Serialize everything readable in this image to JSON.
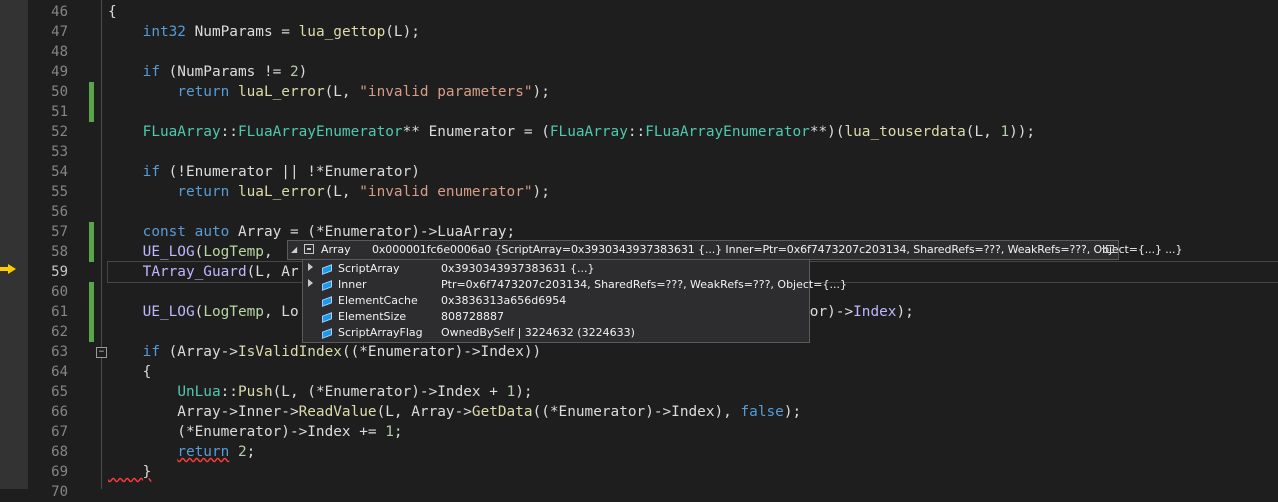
{
  "editor": {
    "line_numbers": [
      "46",
      "47",
      "48",
      "49",
      "50",
      "51",
      "52",
      "53",
      "54",
      "55",
      "56",
      "57",
      "58",
      "59",
      "60",
      "61",
      "62",
      "63",
      "64",
      "65",
      "66",
      "67",
      "68",
      "69",
      "70"
    ],
    "current_line_number": "59",
    "lines": [
      {
        "n": "46",
        "tokens": [
          {
            "t": "{",
            "c": "plain"
          }
        ]
      },
      {
        "n": "47",
        "tokens": [
          {
            "t": "    ",
            "c": "plain"
          },
          {
            "t": "int32",
            "c": "kw"
          },
          {
            "t": " NumParams = ",
            "c": "plain"
          },
          {
            "t": "lua_gettop",
            "c": "fn"
          },
          {
            "t": "(L);",
            "c": "plain"
          }
        ]
      },
      {
        "n": "48",
        "tokens": []
      },
      {
        "n": "49",
        "tokens": [
          {
            "t": "    ",
            "c": "plain"
          },
          {
            "t": "if",
            "c": "kw"
          },
          {
            "t": " (NumParams != ",
            "c": "plain"
          },
          {
            "t": "2",
            "c": "num"
          },
          {
            "t": ")",
            "c": "plain"
          }
        ]
      },
      {
        "n": "50",
        "tokens": [
          {
            "t": "        ",
            "c": "plain"
          },
          {
            "t": "return",
            "c": "kw"
          },
          {
            "t": " ",
            "c": "plain"
          },
          {
            "t": "luaL_error",
            "c": "fn"
          },
          {
            "t": "(L, ",
            "c": "plain"
          },
          {
            "t": "\"invalid parameters\"",
            "c": "str"
          },
          {
            "t": ");",
            "c": "plain"
          }
        ]
      },
      {
        "n": "51",
        "tokens": []
      },
      {
        "n": "52",
        "tokens": [
          {
            "t": "    ",
            "c": "plain"
          },
          {
            "t": "FLuaArray",
            "c": "type"
          },
          {
            "t": "::",
            "c": "plain"
          },
          {
            "t": "FLuaArrayEnumerator",
            "c": "type"
          },
          {
            "t": "** Enumerator = (",
            "c": "plain"
          },
          {
            "t": "FLuaArray",
            "c": "type"
          },
          {
            "t": "::",
            "c": "plain"
          },
          {
            "t": "FLuaArrayEnumerator",
            "c": "type"
          },
          {
            "t": "**)(",
            "c": "plain"
          },
          {
            "t": "lua_touserdata",
            "c": "fn"
          },
          {
            "t": "(L, ",
            "c": "plain"
          },
          {
            "t": "1",
            "c": "num"
          },
          {
            "t": "));",
            "c": "plain"
          }
        ]
      },
      {
        "n": "53",
        "tokens": []
      },
      {
        "n": "54",
        "tokens": [
          {
            "t": "    ",
            "c": "plain"
          },
          {
            "t": "if",
            "c": "kw"
          },
          {
            "t": " (!Enumerator || !*Enumerator)",
            "c": "plain"
          }
        ]
      },
      {
        "n": "55",
        "tokens": [
          {
            "t": "        ",
            "c": "plain"
          },
          {
            "t": "return",
            "c": "kw"
          },
          {
            "t": " ",
            "c": "plain"
          },
          {
            "t": "luaL_error",
            "c": "fn"
          },
          {
            "t": "(L, ",
            "c": "plain"
          },
          {
            "t": "\"invalid enumerator\"",
            "c": "str"
          },
          {
            "t": ");",
            "c": "plain"
          }
        ]
      },
      {
        "n": "56",
        "tokens": []
      },
      {
        "n": "57",
        "tokens": [
          {
            "t": "    ",
            "c": "plain"
          },
          {
            "t": "const",
            "c": "kw"
          },
          {
            "t": " ",
            "c": "plain"
          },
          {
            "t": "auto",
            "c": "kw"
          },
          {
            "t": " Array = (*Enumerator)->LuaArray;",
            "c": "plain"
          }
        ]
      },
      {
        "n": "58",
        "tokens": [
          {
            "t": "    ",
            "c": "plain"
          },
          {
            "t": "UE_LOG",
            "c": "macro"
          },
          {
            "t": "(",
            "c": "plain"
          },
          {
            "t": "LogTemp",
            "c": "enum"
          },
          {
            "t": ",",
            "c": "plain"
          }
        ]
      },
      {
        "n": "59",
        "tokens": [
          {
            "t": "    ",
            "c": "plain"
          },
          {
            "t": "TArray_Guard",
            "c": "macro"
          },
          {
            "t": "(L, Ar",
            "c": "plain"
          }
        ]
      },
      {
        "n": "60",
        "tokens": []
      },
      {
        "n": "61",
        "tokens": [
          {
            "t": "    ",
            "c": "plain"
          },
          {
            "t": "UE_LOG",
            "c": "macro"
          },
          {
            "t": "(",
            "c": "plain"
          },
          {
            "t": "LogTemp",
            "c": "enum"
          },
          {
            "t": ", Lo",
            "c": "plain"
          },
          {
            "t": "                                          ",
            "c": "plain"
          },
          {
            "t": "ame",
            "c": "fn"
          },
          {
            "t": "(), (*Enumerator)->",
            "c": "plain"
          },
          {
            "t": "Index",
            "c": "macro"
          },
          {
            "t": ");",
            "c": "plain"
          }
        ]
      },
      {
        "n": "62",
        "tokens": []
      },
      {
        "n": "63",
        "tokens": [
          {
            "t": "    ",
            "c": "plain"
          },
          {
            "t": "if",
            "c": "kw"
          },
          {
            "t": " (Array->",
            "c": "plain"
          },
          {
            "t": "IsValidIndex",
            "c": "fn"
          },
          {
            "t": "((*Enumerator)->Index))",
            "c": "plain"
          }
        ]
      },
      {
        "n": "64",
        "tokens": [
          {
            "t": "    {",
            "c": "plain"
          }
        ]
      },
      {
        "n": "65",
        "tokens": [
          {
            "t": "        ",
            "c": "plain"
          },
          {
            "t": "UnLua",
            "c": "type"
          },
          {
            "t": "::",
            "c": "plain"
          },
          {
            "t": "Push",
            "c": "fn"
          },
          {
            "t": "(L, (*Enumerator)->Index + ",
            "c": "plain"
          },
          {
            "t": "1",
            "c": "num"
          },
          {
            "t": ");",
            "c": "plain"
          }
        ]
      },
      {
        "n": "66",
        "tokens": [
          {
            "t": "        Array->Inner->",
            "c": "plain"
          },
          {
            "t": "ReadValue",
            "c": "fn"
          },
          {
            "t": "(L, Array->",
            "c": "plain"
          },
          {
            "t": "GetData",
            "c": "fn"
          },
          {
            "t": "((*Enumerator)->Index), ",
            "c": "plain"
          },
          {
            "t": "false",
            "c": "kw"
          },
          {
            "t": ");",
            "c": "plain"
          }
        ]
      },
      {
        "n": "67",
        "tokens": [
          {
            "t": "        (*Enumerator)->Index += ",
            "c": "plain"
          },
          {
            "t": "1",
            "c": "num"
          },
          {
            "t": ";",
            "c": "plain"
          }
        ]
      },
      {
        "n": "68",
        "tokens": [
          {
            "t": "        ",
            "c": "plain"
          },
          {
            "t": "return",
            "c": "kw",
            "sq": true
          },
          {
            "t": " ",
            "c": "plain"
          },
          {
            "t": "2",
            "c": "num"
          },
          {
            "t": ";",
            "c": "plain"
          }
        ]
      },
      {
        "n": "69",
        "tokens": [
          {
            "t": "    }",
            "c": "plain",
            "sq": true
          }
        ]
      },
      {
        "n": "70",
        "tokens": []
      }
    ]
  },
  "datatip": {
    "name": "Array",
    "value": "0x000001fc6e0006a0 {ScriptArray=0x3930343937383631 {...} Inner=Ptr=0x6f7473207c203134, SharedRefs=???, WeakRefs=???, Object={...} ...}",
    "children": [
      {
        "name": "ScriptArray",
        "value": "0x3930343937383631 {...}",
        "expandable": true
      },
      {
        "name": "Inner",
        "value": "Ptr=0x6f7473207c203134, SharedRefs=???, WeakRefs=???, Object={...}",
        "expandable": true
      },
      {
        "name": "ElementCache",
        "value": "0x3836313a656d6954",
        "expandable": false
      },
      {
        "name": "ElementSize",
        "value": "808728887",
        "expandable": false
      },
      {
        "name": "ScriptArrayFlag",
        "value": "OwnedBySelf | 3224632 (3224633)",
        "expandable": false
      }
    ]
  },
  "colors": {
    "background": "#1e1e1e",
    "keyword": "#569cd6",
    "type": "#4ec9b0",
    "function": "#dcdcaa",
    "string": "#d69d85",
    "number": "#b5cea8",
    "macro": "#beb7ff",
    "change_bar": "#57a64a",
    "exec_arrow": "#ffcc00"
  }
}
